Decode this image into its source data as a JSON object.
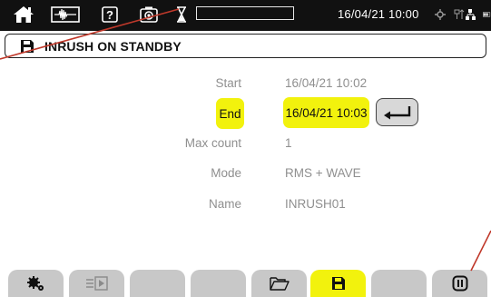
{
  "status_bar": {
    "datetime": "16/04/21 10:00",
    "icons": [
      "home-icon",
      "waveform-mode-icon",
      "help-icon",
      "camera-icon",
      "hourglass-icon",
      "progress-bar",
      "gps-icon",
      "usb-network-icon",
      "battery-icon"
    ]
  },
  "title": {
    "icon": "save-icon",
    "text": "INRUSH ON STANDBY"
  },
  "fields": {
    "start": {
      "label": "Start",
      "value": "16/04/21 10:02"
    },
    "end": {
      "label": "End",
      "value": "16/04/21 10:03"
    },
    "max_count": {
      "label": "Max count",
      "value": "1"
    },
    "mode": {
      "label": "Mode",
      "value": "RMS + WAVE"
    },
    "name": {
      "label": "Name",
      "value": "INRUSH01"
    }
  },
  "tabs": [
    {
      "icon": "settings-icon",
      "active": false
    },
    {
      "icon": "list-play-icon",
      "active": false
    },
    {
      "icon": "",
      "active": false
    },
    {
      "icon": "",
      "active": false
    },
    {
      "icon": "folder-open-icon",
      "active": false
    },
    {
      "icon": "save-icon",
      "active": true
    },
    {
      "icon": "",
      "active": false
    },
    {
      "icon": "pause-icon",
      "active": false
    }
  ],
  "colors": {
    "highlight": "#f2f20d",
    "status_bar": "#111111",
    "tab": "#c8c8c8",
    "pointer": "#c0392b"
  }
}
